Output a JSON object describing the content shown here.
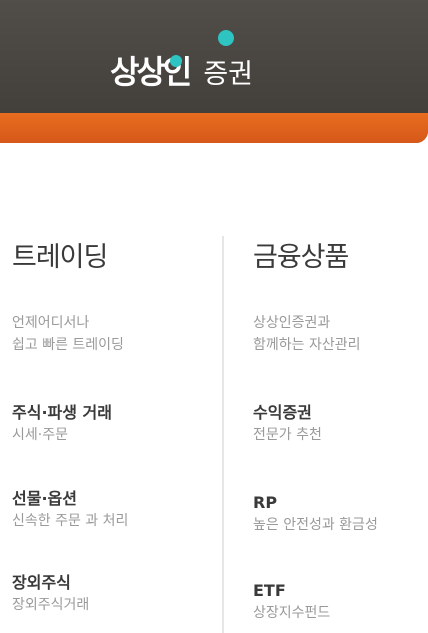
{
  "header": {
    "logo_mark": "상상인",
    "brand": "증권",
    "colors": {
      "dark": "#4a4642",
      "orange": "#e2651c",
      "teal": "#2ec4c2"
    }
  },
  "trading": {
    "title": "트레이딩",
    "items": [
      {
        "lines": [
          "언제어디서나",
          "쉽고 빠른 트레이딩"
        ]
      },
      {
        "title": "주식·파생 거래",
        "sub": "시세·주문"
      },
      {
        "title": "선물·옵션",
        "sub": "신속한 주문 과 처리"
      },
      {
        "title": "장외주식",
        "sub": "장외주식거래"
      }
    ]
  },
  "products": {
    "title": "금융상품",
    "items": [
      {
        "lines": [
          "상상인증권과",
          "함께하는 자산관리"
        ]
      },
      {
        "title": "수익증권",
        "sub": "전문가 추천"
      },
      {
        "title": "RP",
        "sub": "높은 안전성과 환금성"
      },
      {
        "title": "ETF",
        "sub": "상장지수펀드"
      }
    ]
  }
}
